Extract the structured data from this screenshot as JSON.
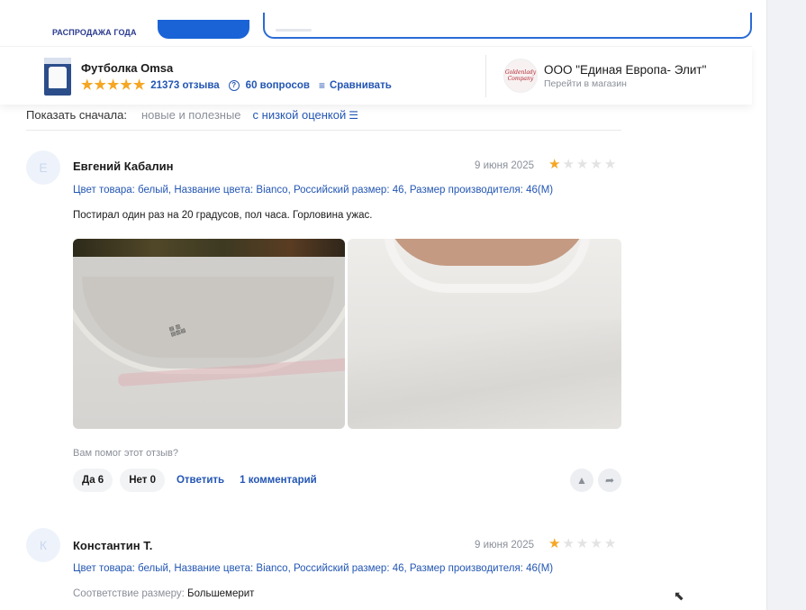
{
  "top": {
    "sale_label": "РАСПРОДАЖА ГОДА"
  },
  "product": {
    "title": "Футболка Omsa",
    "rating_stars": 5,
    "reviews": "21373 отзыва",
    "questions": "60 вопросов",
    "compare": "Сравнивать",
    "star_color": "#f5a623"
  },
  "seller": {
    "logo_text": "Goldenlady Company",
    "name": "ООО \"Единая Европа- Элит\"",
    "link": "Перейти в магазин"
  },
  "sort": {
    "label": "Показать сначала:",
    "options": [
      "новые и полезные",
      "с низкой оценкой"
    ],
    "active_index": 1
  },
  "reviews": [
    {
      "avatar_letter": "Е",
      "author": "Евгений Кабалин",
      "date": "9 июня 2025",
      "rating": 1,
      "props": "Цвет товара: белый, Название цвета: Bianco, Российский размер: 46, Размер производителя: 46(M)",
      "text": "Постирал один раз на 20 градусов, пол часа. Горловина ужас.",
      "helpful_question": "Вам помог этот отзыв?",
      "yes": "Да 6",
      "no": "Нет 0",
      "reply": "Ответить",
      "comments": "1 комментарий"
    },
    {
      "avatar_letter": "К",
      "author": "Константин Т.",
      "date": "9 июня 2025",
      "rating": 1,
      "props": "Цвет товара: белый, Название цвета: Bianco, Российский размер: 46, Размер производителя: 46(M)",
      "fit_label": "Соответствие размеру:",
      "fit_value": "Большемерит"
    }
  ],
  "colors": {
    "link": "#2356b3",
    "accent_blue": "#1a63d6",
    "muted": "#8a8f98"
  }
}
